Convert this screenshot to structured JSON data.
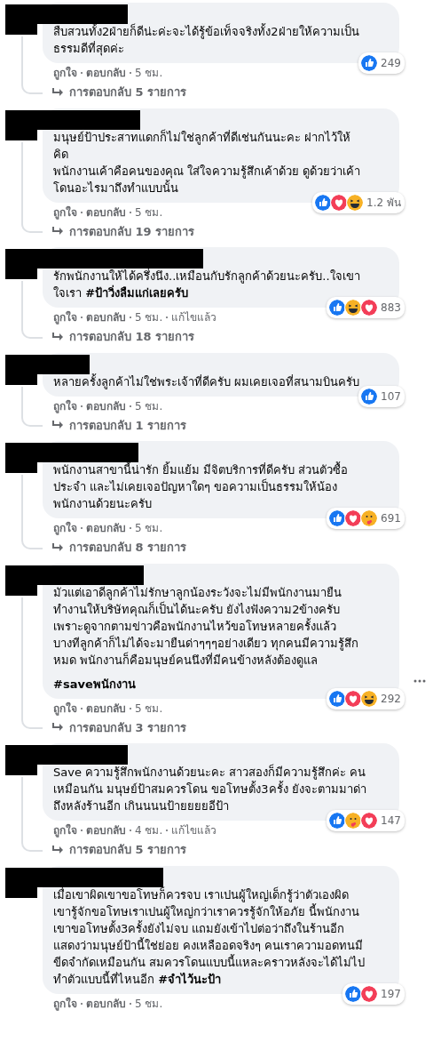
{
  "comments": [
    {
      "text": "สืบสวนทั้ง2ฝ่ายก็ดีน่ะค่ะจะได้รู้ข้อเท็จจริงทั้ง2ฝ่ายให้ความเป็น\nธรรมดีที่สุดค่ะ",
      "reactions": [
        {
          "kind": "like"
        }
      ],
      "reaction_count": "249",
      "like_label": "ถูกใจ",
      "reply_label": "ตอบกลับ",
      "time": "5 ชม.",
      "replies": "การตอบกลับ 5 รายการ",
      "menu": false
    },
    {
      "text": "มนุษย์ป้าประสาทแดกก็ไม่ใช่ลูกค้าที่ดีเช่นกันนะคะ ฝากไว้ให้\nคิด\nพนักงานเค้าคือคนของคุณ ใส่ใจความรู้สึกเค้าด้วย ดูด้วยว่าเค้า\nโดนอะไรมาถึงทำแบบนั้น",
      "reactions": [
        {
          "kind": "like"
        },
        {
          "kind": "love"
        },
        {
          "kind": "haha"
        }
      ],
      "reaction_count": "1.2 พัน",
      "like_label": "ถูกใจ",
      "reply_label": "ตอบกลับ",
      "time": "5 ชม.",
      "replies": "การตอบกลับ 19 รายการ",
      "menu": false
    },
    {
      "text": "รักพนักงานให้ได้ครึ่งนึง..เหมือนกับรักลูกค้าด้วยนะครับ..ใจเขา\nใจเรา **#ป้าวิ่งลืมแก่เลยครับ**",
      "reactions": [
        {
          "kind": "like"
        },
        {
          "kind": "haha"
        },
        {
          "kind": "love"
        }
      ],
      "reaction_count": "883",
      "like_label": "ถูกใจ",
      "reply_label": "ตอบกลับ",
      "time": "5 ชม.",
      "edited": "แก้ไขแล้ว",
      "replies": "การตอบกลับ 18 รายการ",
      "menu": false
    },
    {
      "text": "หลายครั้งลูกค้าไม่ใช่พระเจ้าที่ดีครับ ผมเคยเจอที่สนามบินครับ",
      "reactions": [
        {
          "kind": "like"
        }
      ],
      "reaction_count": "107",
      "like_label": "ถูกใจ",
      "reply_label": "ตอบกลับ",
      "time": "5 ชม.",
      "replies": "การตอบกลับ 1 รายการ",
      "menu": false
    },
    {
      "text": "พนักงานสาขานี้น่ารัก ยิ้มแย้ม มีจิตบริการที่ดีครับ ส่วนตัวซื้อ\nประจำ และไม่เคยเจอปัญหาใดๆ ขอความเป็นธรรมให้น้อง\nพนักงานด้วยนะครับ",
      "reactions": [
        {
          "kind": "like"
        },
        {
          "kind": "love"
        },
        {
          "kind": "care"
        }
      ],
      "reaction_count": "691",
      "like_label": "ถูกใจ",
      "reply_label": "ตอบกลับ",
      "time": "5 ชม.",
      "replies": "การตอบกลับ 8 รายการ",
      "menu": false
    },
    {
      "text": "มัวแต่เอาดีลูกค้าไม่รักษาลูกน้องระวังจะไม่มีพนักงานมายืน\nทำงานให้บริษัทคุณก็เป็นได้นะครับ ยังไงฟังความ2ข้างครับ\nเพราะดูจากตามข่าวคือพนักงานไหว้ขอโทษหลายครั้งแล้ว\nบางทีลูกค้าก็ไม่ได้จะมายืนด่าๆๆๆอย่างเดียว ทุกคนมีความรู้สึก\nหมด พนักงานก็คือมนุษย์คนนึงที่มีคนข้างหลังต้องดูแล",
      "hashtag": "#saveพนักงาน",
      "reactions": [
        {
          "kind": "like"
        },
        {
          "kind": "love"
        },
        {
          "kind": "haha"
        }
      ],
      "reaction_count": "292",
      "like_label": "ถูกใจ",
      "reply_label": "ตอบกลับ",
      "time": "5 ชม.",
      "replies": "การตอบกลับ 3 รายการ",
      "menu": true
    },
    {
      "text": "Save ความรู้สึกพนักงานด้วยนะคะ สาวสองก็มีความรู้สึกค่ะ คน\nเหมือนกัน มนุษย์ป้าสมควรโดน ขอโทษตั้ง3ครั้ง ยังจะตามมาด่า\nถึงหลังร้านอีก เกินนนนป้ายยยยอีป้า",
      "reactions": [
        {
          "kind": "like"
        },
        {
          "kind": "care"
        },
        {
          "kind": "love"
        }
      ],
      "reaction_count": "147",
      "like_label": "ถูกใจ",
      "reply_label": "ตอบกลับ",
      "time": "4 ชม.",
      "edited": "แก้ไขแล้ว",
      "replies": "การตอบกลับ 5 รายการ",
      "menu": false
    },
    {
      "text": "เมื่อเขาผิดเขาขอโทษก็ควรจบ เราเปนผู้ใหญ่เด็กรู้ว่าตัวเองผิด\nเขารู้จักขอโทษเราเปนผู้ใหญ่กว่าเราควรรู้จักให้อภัย นี้พนักงาน\nเขาขอโทษตั้ง3ครั้งยังไม่จบ แถมยังเข้าไปต่อว่าถึงในร้านอีก\nแสดงว่ามนุษย์ป้านี้ใช่ย่อย คงเหลืออดจริงๆ คนเราความอดทนมี\nขีดจำกัดเหมือนกัน สมควรโดนแบบนี้แหละคราวหลังจะได้ไม่ไป\nทำตัวแบบนี้ที่ไหนอีก **#จำไว้นะป้า**",
      "reactions": [
        {
          "kind": "like"
        },
        {
          "kind": "love"
        }
      ],
      "reaction_count": "197",
      "like_label": "ถูกใจ",
      "reply_label": "ตอบกลับ",
      "time": "5 ชม.",
      "menu": false
    }
  ]
}
